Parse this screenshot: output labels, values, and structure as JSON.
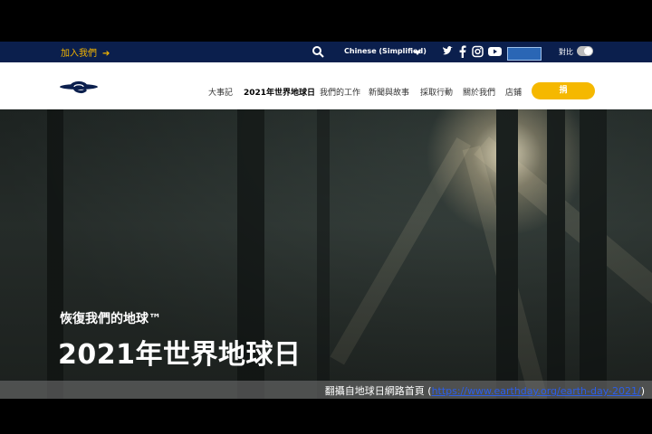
{
  "topbar": {
    "join_label": "加入我們",
    "join_arrow": "➔",
    "language": "Chinese (Simplified)",
    "contrast_label": "對比",
    "colors": {
      "bg": "#0b1f4d",
      "accent": "#f2b400"
    }
  },
  "nav": {
    "items": [
      {
        "label": "大事記"
      },
      {
        "label": "2021年世界地球日",
        "active": true
      },
      {
        "label": "我們的工作"
      },
      {
        "label": "新聞與故事"
      },
      {
        "label": "採取行動"
      },
      {
        "label": "關於我們"
      },
      {
        "label": "店鋪"
      }
    ],
    "donate_label": "捐"
  },
  "hero": {
    "tagline": "恢復我們的地球™",
    "headline": "2021年世界地球日"
  },
  "caption": {
    "prefix": "翻攝自地球日網路首頁 (",
    "url": "https://www.earthday.org/earth-day-2021/",
    "suffix": ")"
  }
}
